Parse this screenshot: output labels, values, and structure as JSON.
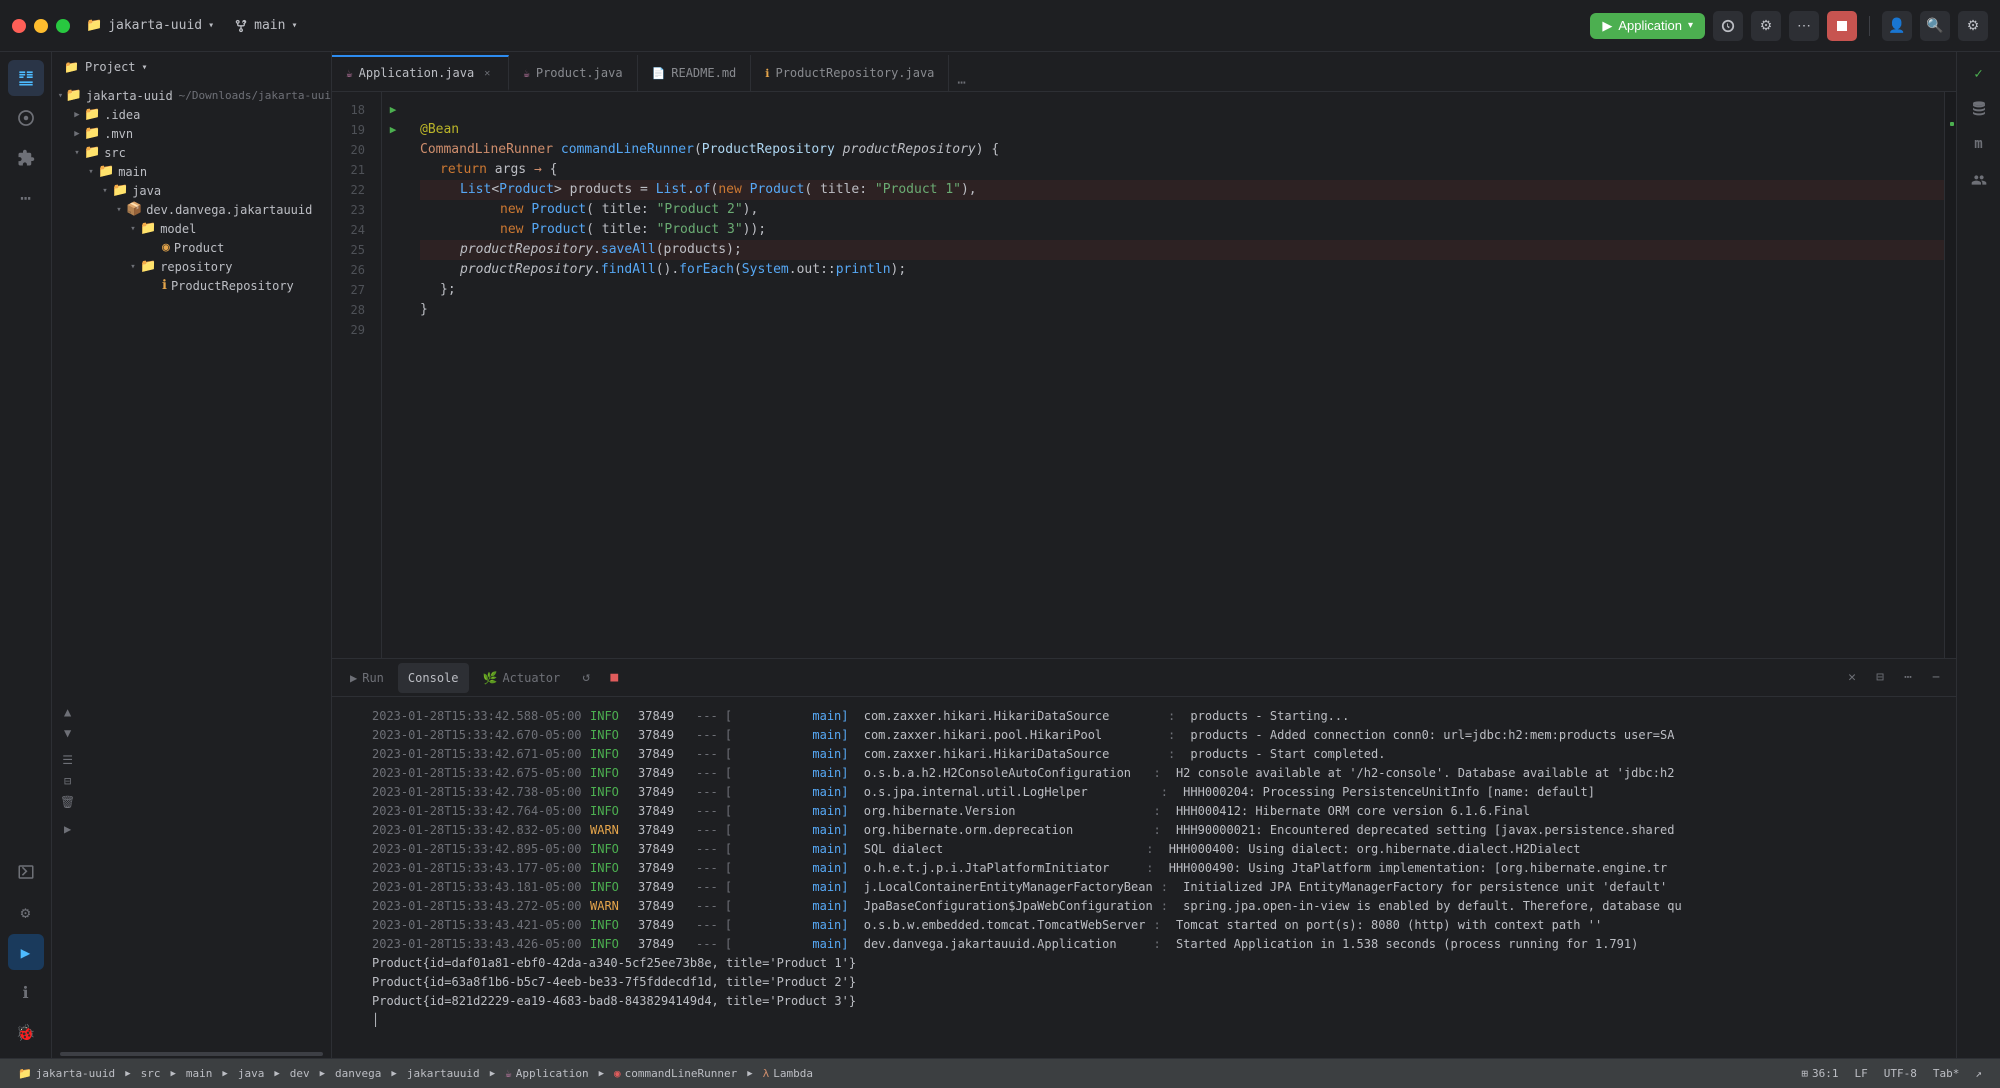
{
  "titlebar": {
    "project": "jakarta-uuid",
    "branch": "main",
    "run_label": "Application",
    "chevron": "▾"
  },
  "tabs": [
    {
      "label": "Application.java",
      "type": "java",
      "active": true,
      "modified": false
    },
    {
      "label": "Product.java",
      "type": "java",
      "active": false,
      "modified": false
    },
    {
      "label": "README.md",
      "type": "md",
      "active": false,
      "modified": false
    },
    {
      "label": "ProductRepository.java",
      "type": "java",
      "active": false,
      "modified": false
    }
  ],
  "sidebar": {
    "header": "Project",
    "tree": [
      {
        "label": "jakarta-uuid",
        "type": "project",
        "depth": 0,
        "expanded": true,
        "path": "~/Downloads/jakarta-uui"
      },
      {
        "label": ".idea",
        "type": "folder",
        "depth": 1,
        "expanded": false
      },
      {
        "label": ".mvn",
        "type": "folder",
        "depth": 1,
        "expanded": false
      },
      {
        "label": "src",
        "type": "folder",
        "depth": 1,
        "expanded": true
      },
      {
        "label": "main",
        "type": "folder",
        "depth": 2,
        "expanded": true
      },
      {
        "label": "java",
        "type": "folder",
        "depth": 3,
        "expanded": true
      },
      {
        "label": "dev.danvega.jakartauuid",
        "type": "package",
        "depth": 4,
        "expanded": true
      },
      {
        "label": "model",
        "type": "folder",
        "depth": 5,
        "expanded": true
      },
      {
        "label": "Product",
        "type": "class",
        "depth": 6
      },
      {
        "label": "repository",
        "type": "folder",
        "depth": 5,
        "expanded": true
      },
      {
        "label": "ProductRepository",
        "type": "interface",
        "depth": 6
      }
    ]
  },
  "code": {
    "lines": [
      {
        "num": 18,
        "content": ""
      },
      {
        "num": 19,
        "content": "    @Bean",
        "has_run": true
      },
      {
        "num": 20,
        "content": "    CommandLineRunner commandLineRunner(ProductRepository productRepository) {",
        "has_run": true
      },
      {
        "num": 21,
        "content": "        return args → {"
      },
      {
        "num": 22,
        "content": "            List<Product> products = List.of(new Product( title: \"Product 1\"),"
      },
      {
        "num": 23,
        "content": "                    new Product( title: \"Product 2\"),"
      },
      {
        "num": 24,
        "content": "                    new Product( title: \"Product 3\"));"
      },
      {
        "num": 25,
        "content": "            productRepository.saveAll(products);"
      },
      {
        "num": 26,
        "content": "            productRepository.findAll().forEach(System.out::println);"
      },
      {
        "num": 27,
        "content": "        };"
      },
      {
        "num": 28,
        "content": "    }"
      },
      {
        "num": 29,
        "content": ""
      }
    ]
  },
  "panel": {
    "tabs": [
      {
        "label": "Run",
        "icon": "▶",
        "active": false
      },
      {
        "label": "Console",
        "icon": "",
        "active": true
      },
      {
        "label": "Actuator",
        "icon": "🌿",
        "active": false
      }
    ],
    "logs": [
      {
        "ts": "2023-01-28T15:33:42.588-05:00",
        "level": "INFO",
        "pid": "37849",
        "thread": "main",
        "logger": "com.zaxxer.hikari.HikariDataSource",
        "msg": ": products - Starting..."
      },
      {
        "ts": "2023-01-28T15:33:42.670-05:00",
        "level": "INFO",
        "pid": "37849",
        "thread": "main",
        "logger": "com.zaxxer.hikari.pool.HikariPool",
        "msg": ": products - Added connection conn0: url=jdbc:h2:mem:products user=SA"
      },
      {
        "ts": "2023-01-28T15:33:42.671-05:00",
        "level": "INFO",
        "pid": "37849",
        "thread": "main",
        "logger": "com.zaxxer.hikari.HikariDataSource",
        "msg": ": products - Start completed."
      },
      {
        "ts": "2023-01-28T15:33:42.675-05:00",
        "level": "INFO",
        "pid": "37849",
        "thread": "main",
        "logger": "o.s.b.a.h2.H2ConsoleAutoConfiguration",
        "msg": ": H2 console available at '/h2-console'. Database available at 'jdbc:h2"
      },
      {
        "ts": "2023-01-28T15:33:42.738-05:00",
        "level": "INFO",
        "pid": "37849",
        "thread": "main",
        "logger": "o.s.jpa.internal.util.LogHelper",
        "msg": ": HHH000204: Processing PersistenceUnitInfo [name: default]"
      },
      {
        "ts": "2023-01-28T15:33:42.764-05:00",
        "level": "INFO",
        "pid": "37849",
        "thread": "main",
        "logger": "org.hibernate.Version",
        "msg": ": HHH000412: Hibernate ORM core version 6.1.6.Final"
      },
      {
        "ts": "2023-01-28T15:33:42.832-05:00",
        "level": "WARN",
        "pid": "37849",
        "thread": "main",
        "logger": "org.hibernate.orm.deprecation",
        "msg": ": HHH90000021: Encountered deprecated setting [javax.persistence.shared"
      },
      {
        "ts": "2023-01-28T15:33:42.895-05:00",
        "level": "INFO",
        "pid": "37849",
        "thread": "main",
        "logger": "SQL dialect",
        "msg": ": HHH000400: Using dialect: org.hibernate.dialect.H2Dialect"
      },
      {
        "ts": "2023-01-28T15:33:43.177-05:00",
        "level": "INFO",
        "pid": "37849",
        "thread": "main",
        "logger": "o.h.e.t.j.p.i.JtaPlatformInitiator",
        "msg": ": HHH000490: Using JtaPlatform implementation: [org.hibernate.engine.tr"
      },
      {
        "ts": "2023-01-28T15:33:43.181-05:00",
        "level": "INFO",
        "pid": "37849",
        "thread": "main",
        "logger": "j.LocalContainerEntityManagerFactoryBean",
        "msg": ": Initialized JPA EntityManagerFactory for persistence unit 'default'"
      },
      {
        "ts": "2023-01-28T15:33:43.272-05:00",
        "level": "WARN",
        "pid": "37849",
        "thread": "main",
        "logger": "JpaBaseConfiguration$JpaWebConfiguration",
        "msg": ": spring.jpa.open-in-view is enabled by default. Therefore, database qu"
      },
      {
        "ts": "2023-01-28T15:33:43.421-05:00",
        "level": "INFO",
        "pid": "37849",
        "thread": "main",
        "logger": "o.s.b.w.embedded.tomcat.TomcatWebServer",
        "msg": ": Tomcat started on port(s): 8080 (http) with context path ''"
      },
      {
        "ts": "2023-01-28T15:33:43.426-05:00",
        "level": "INFO",
        "pid": "37849",
        "thread": "main",
        "logger": "dev.danvega.jakartauuid.Application",
        "msg": ": Started Application in 1.538 seconds (process running for 1.791)"
      }
    ],
    "products": [
      "Product{id=daf01a81-ebf0-42da-a340-5cf25ee73b8e, title='Product 1'}",
      "Product{id=63a8f1b6-b5c7-4eeb-be33-7f5fddecdf1d, title='Product 2'}",
      "Product{id=821d2229-ea19-4683-bad8-8438294149d4, title='Product 3'}"
    ]
  },
  "statusbar": {
    "project": "jakarta-uuid",
    "breadcrumbs": [
      "src",
      "main",
      "java",
      "dev",
      "danvega",
      "jakartauuid",
      "Application",
      "commandLineRunner",
      "Lambda"
    ],
    "position": "36:1",
    "line_ending": "LF",
    "encoding": "UTF-8",
    "indent": "Tab*"
  }
}
